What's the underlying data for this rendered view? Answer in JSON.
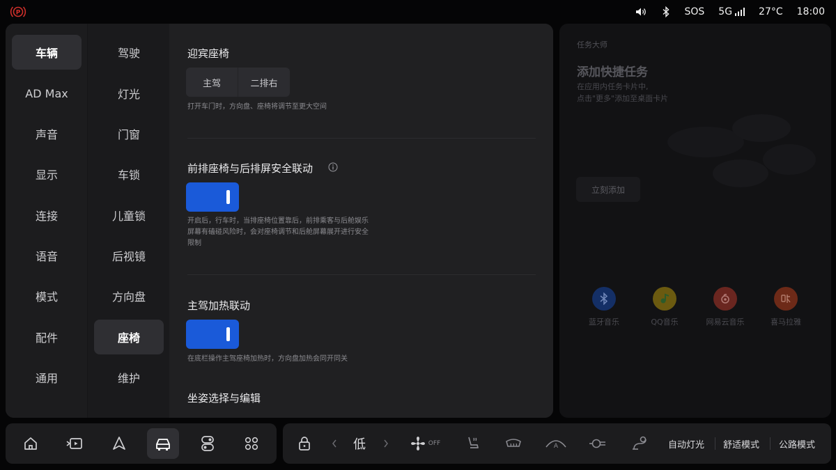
{
  "status": {
    "sos": "SOS",
    "network": "5G",
    "temperature": "27°C",
    "time": "18:00",
    "colors": {
      "brake_warning": "#d0302b"
    }
  },
  "nav_primary": [
    {
      "label": "车辆",
      "active": true
    },
    {
      "label": "AD Max"
    },
    {
      "label": "声音"
    },
    {
      "label": "显示"
    },
    {
      "label": "连接"
    },
    {
      "label": "语音"
    },
    {
      "label": "模式"
    },
    {
      "label": "配件"
    },
    {
      "label": "通用"
    }
  ],
  "nav_secondary": [
    {
      "label": "驾驶"
    },
    {
      "label": "灯光"
    },
    {
      "label": "门窗"
    },
    {
      "label": "车锁"
    },
    {
      "label": "儿童锁"
    },
    {
      "label": "后视镜"
    },
    {
      "label": "方向盘"
    },
    {
      "label": "座椅",
      "active": true
    },
    {
      "label": "维护"
    }
  ],
  "content": {
    "welcome_seat": {
      "title": "迎宾座椅",
      "options": [
        "主驾",
        "二排右"
      ],
      "desc": "打开车门时，方向盘、座椅将调节至更大空间"
    },
    "safety_link": {
      "title": "前排座椅与后排屏安全联动",
      "enabled": true,
      "desc": "开启后，行车时，当排座椅位置靠后，前排乘客与后舱娱乐屏幕有磕碰风险时，会对座椅调节和后舱屏幕展开进行安全限制"
    },
    "heating_link": {
      "title": "主驾加热联动",
      "enabled": true,
      "desc": "在底栏操作主驾座椅加热时，方向盘加热会同开同关"
    },
    "posture": {
      "title": "坐姿选择与编辑"
    },
    "colors": {
      "toggle_on": "#1a5ad9"
    }
  },
  "task_card": {
    "small_title": "任务大师",
    "title": "添加快捷任务",
    "desc_line1": "在应用内任务卡片中,",
    "desc_line2": "点击\"更多\"添加至桌面卡片",
    "add_button": "立刻添加",
    "apps": [
      {
        "label": "蓝牙音乐",
        "icon": "bluetooth-icon",
        "color": "#1d5bd6"
      },
      {
        "label": "QQ音乐",
        "icon": "qq-music-icon",
        "color": "#e8b800"
      },
      {
        "label": "网易云音乐",
        "icon": "netease-music-icon",
        "color": "#d53a2e"
      },
      {
        "label": "喜马拉雅",
        "icon": "ximalaya-icon",
        "color": "#e84b22"
      }
    ]
  },
  "dock": {
    "fan_level": "低",
    "fan_state": "OFF",
    "auto_light": "自动灯光",
    "comfort_mode": "舒适模式",
    "road_mode": "公路模式"
  }
}
